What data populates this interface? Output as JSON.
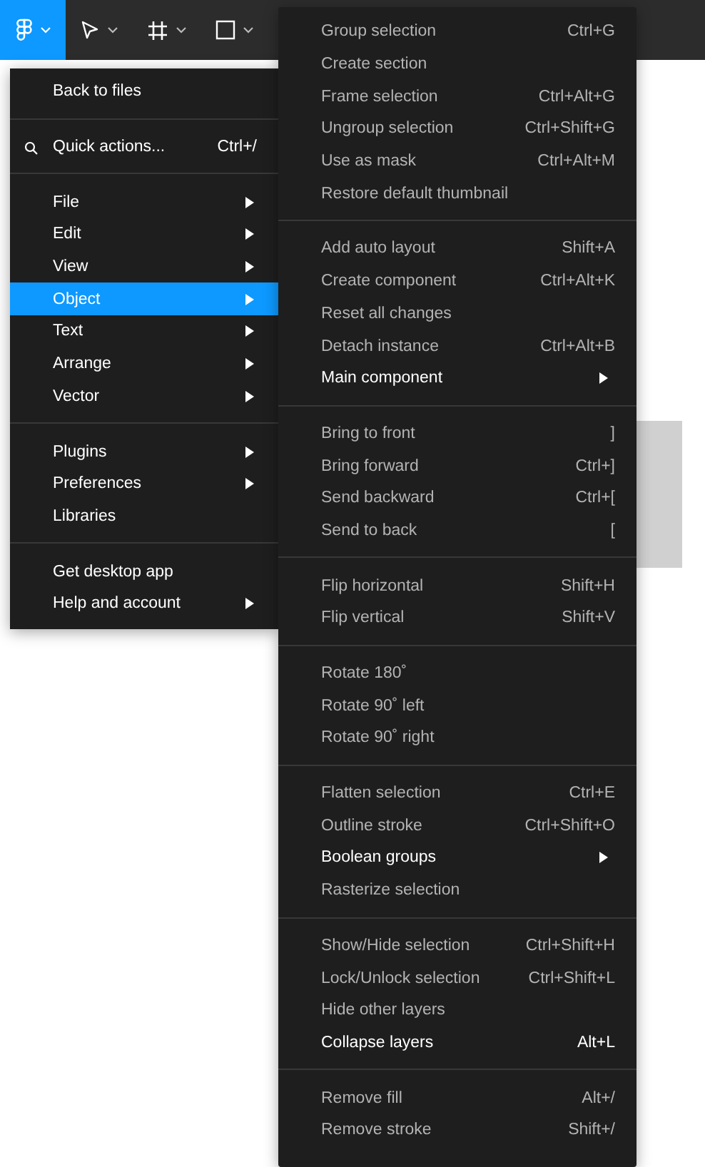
{
  "toolbar": {
    "tools": [
      {
        "kind": "logo",
        "selected": true
      },
      {
        "kind": "move",
        "selected": false
      },
      {
        "kind": "frame",
        "selected": false
      },
      {
        "kind": "shape",
        "selected": false
      }
    ]
  },
  "main_menu": {
    "sections": [
      [
        {
          "kind": "plain",
          "label": "Back to files",
          "submenu": false,
          "selected": false
        }
      ],
      [
        {
          "kind": "search",
          "label": "Quick actions...",
          "shortcut": "Ctrl+/",
          "submenu": false,
          "selected": false
        }
      ],
      [
        {
          "kind": "plain",
          "label": "File",
          "submenu": true,
          "selected": false
        },
        {
          "kind": "plain",
          "label": "Edit",
          "submenu": true,
          "selected": false
        },
        {
          "kind": "plain",
          "label": "View",
          "submenu": true,
          "selected": false
        },
        {
          "kind": "plain",
          "label": "Object",
          "submenu": true,
          "selected": true
        },
        {
          "kind": "plain",
          "label": "Text",
          "submenu": true,
          "selected": false
        },
        {
          "kind": "plain",
          "label": "Arrange",
          "submenu": true,
          "selected": false
        },
        {
          "kind": "plain",
          "label": "Vector",
          "submenu": true,
          "selected": false
        }
      ],
      [
        {
          "kind": "plain",
          "label": "Plugins",
          "submenu": true,
          "selected": false
        },
        {
          "kind": "plain",
          "label": "Preferences",
          "submenu": true,
          "selected": false
        },
        {
          "kind": "plain",
          "label": "Libraries",
          "submenu": false,
          "selected": false
        }
      ],
      [
        {
          "kind": "plain",
          "label": "Get desktop app",
          "submenu": false,
          "selected": false
        },
        {
          "kind": "plain",
          "label": "Help and account",
          "submenu": true,
          "selected": false
        }
      ]
    ]
  },
  "object_submenu": {
    "sections": [
      [
        {
          "label": "Group selection",
          "shortcut": "Ctrl+G",
          "submenu": false,
          "disabled": true
        },
        {
          "label": "Create section",
          "submenu": false,
          "disabled": true
        },
        {
          "label": "Frame selection",
          "shortcut": "Ctrl+Alt+G",
          "submenu": false,
          "disabled": true
        },
        {
          "label": "Ungroup selection",
          "shortcut": "Ctrl+Shift+G",
          "submenu": false,
          "disabled": true
        },
        {
          "label": "Use as mask",
          "shortcut": "Ctrl+Alt+M",
          "submenu": false,
          "disabled": true
        },
        {
          "label": "Restore default thumbnail",
          "submenu": false,
          "disabled": true
        }
      ],
      [
        {
          "label": "Add auto layout",
          "shortcut": "Shift+A",
          "submenu": false,
          "disabled": true
        },
        {
          "label": "Create component",
          "shortcut": "Ctrl+Alt+K",
          "submenu": false,
          "disabled": true
        },
        {
          "label": "Reset all changes",
          "submenu": false,
          "disabled": true
        },
        {
          "label": "Detach instance",
          "shortcut": "Ctrl+Alt+B",
          "submenu": false,
          "disabled": true
        },
        {
          "label": "Main component",
          "submenu": true,
          "disabled": false
        }
      ],
      [
        {
          "label": "Bring to front",
          "shortcut": "]",
          "submenu": false,
          "disabled": true
        },
        {
          "label": "Bring forward",
          "shortcut": "Ctrl+]",
          "submenu": false,
          "disabled": true
        },
        {
          "label": "Send backward",
          "shortcut": "Ctrl+[",
          "submenu": false,
          "disabled": true
        },
        {
          "label": "Send to back",
          "shortcut": "[",
          "submenu": false,
          "disabled": true
        }
      ],
      [
        {
          "label": "Flip horizontal",
          "shortcut": "Shift+H",
          "submenu": false,
          "disabled": true
        },
        {
          "label": "Flip vertical",
          "shortcut": "Shift+V",
          "submenu": false,
          "disabled": true
        }
      ],
      [
        {
          "label": "Rotate 180˚",
          "submenu": false,
          "disabled": true
        },
        {
          "label": "Rotate 90˚ left",
          "submenu": false,
          "disabled": true
        },
        {
          "label": "Rotate 90˚ right",
          "submenu": false,
          "disabled": true
        }
      ],
      [
        {
          "label": "Flatten selection",
          "shortcut": "Ctrl+E",
          "submenu": false,
          "disabled": true
        },
        {
          "label": "Outline stroke",
          "shortcut": "Ctrl+Shift+O",
          "submenu": false,
          "disabled": true
        },
        {
          "label": "Boolean groups",
          "submenu": true,
          "disabled": false
        },
        {
          "label": "Rasterize selection",
          "submenu": false,
          "disabled": true
        }
      ],
      [
        {
          "label": "Show/Hide selection",
          "shortcut": "Ctrl+Shift+H",
          "submenu": false,
          "disabled": true
        },
        {
          "label": "Lock/Unlock selection",
          "shortcut": "Ctrl+Shift+L",
          "submenu": false,
          "disabled": true
        },
        {
          "label": "Hide other layers",
          "submenu": false,
          "disabled": true
        },
        {
          "label": "Collapse layers",
          "shortcut": "Alt+L",
          "submenu": false,
          "disabled": false
        }
      ],
      [
        {
          "label": "Remove fill",
          "shortcut": "Alt+/",
          "submenu": false,
          "disabled": true
        },
        {
          "label": "Remove stroke",
          "shortcut": "Shift+/",
          "submenu": false,
          "disabled": true
        }
      ]
    ]
  }
}
